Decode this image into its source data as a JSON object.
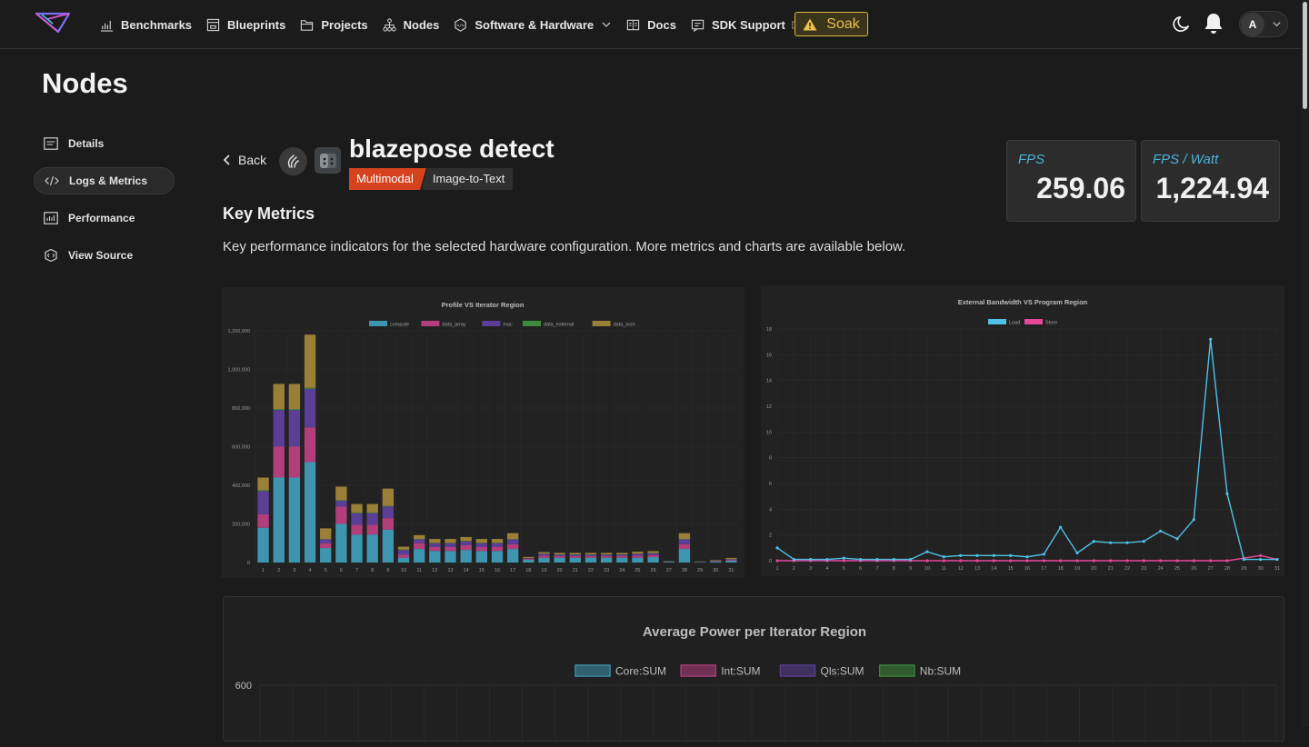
{
  "nav": {
    "items": [
      {
        "label": "Benchmarks",
        "icon": "chart-icon"
      },
      {
        "label": "Blueprints",
        "icon": "blueprint-icon"
      },
      {
        "label": "Projects",
        "icon": "folder-icon"
      },
      {
        "label": "Nodes",
        "icon": "hierarchy-icon"
      },
      {
        "label": "Software & Hardware",
        "icon": "chip-icon"
      },
      {
        "label": "Docs",
        "icon": "book-icon"
      },
      {
        "label": "SDK Support",
        "icon": "support-icon"
      }
    ],
    "soak_label": "Soak",
    "avatar_initial": "A"
  },
  "page": {
    "title": "Nodes"
  },
  "sidebar": {
    "items": [
      {
        "label": "Details",
        "icon": "details-icon"
      },
      {
        "label": "Logs & Metrics",
        "icon": "code-icon",
        "active": true
      },
      {
        "label": "Performance",
        "icon": "performance-icon"
      },
      {
        "label": "View Source",
        "icon": "source-icon"
      }
    ]
  },
  "model": {
    "back_label": "Back",
    "title": "blazepose detect",
    "tag_primary": "Multimodal",
    "tag_secondary": "Image-to-Text"
  },
  "stats": {
    "fps": {
      "label": "FPS",
      "value": "259.06"
    },
    "fps_watt": {
      "label": "FPS / Watt",
      "value": "1,224.94"
    }
  },
  "key_metrics": {
    "title": "Key Metrics",
    "description": "Key performance indicators for the selected hardware configuration. More metrics and charts are available below."
  },
  "colors": {
    "compute": "#3e95b0",
    "data_array": "#b23f7c",
    "mac": "#5b3f96",
    "data_external": "#3d8c3d",
    "data_ocm": "#9a8036",
    "load": "#4fc1e9",
    "store": "#e5489b",
    "accent_red": "#d4431e"
  },
  "chart_data": [
    {
      "type": "bar",
      "stacked": true,
      "title": "Profile VS Iterator Region",
      "categories": [
        "1",
        "2",
        "3",
        "4",
        "5",
        "6",
        "7",
        "8",
        "9",
        "10",
        "11",
        "12",
        "13",
        "14",
        "15",
        "16",
        "17",
        "18",
        "19",
        "20",
        "21",
        "22",
        "23",
        "24",
        "25",
        "26",
        "27",
        "28",
        "29",
        "30",
        "31"
      ],
      "series": [
        {
          "name": "compute",
          "values": [
            180000,
            440000,
            440000,
            520000,
            75000,
            200000,
            145000,
            145000,
            170000,
            25000,
            70000,
            60000,
            60000,
            65000,
            60000,
            60000,
            70000,
            15000,
            25000,
            25000,
            25000,
            25000,
            25000,
            25000,
            25000,
            28000,
            4000,
            70000,
            2000,
            5000,
            10000
          ]
        },
        {
          "name": "data_array",
          "values": [
            70000,
            160000,
            160000,
            180000,
            25000,
            90000,
            50000,
            50000,
            60000,
            15000,
            30000,
            20000,
            20000,
            25000,
            20000,
            20000,
            25000,
            5000,
            10000,
            8000,
            8000,
            8000,
            8000,
            8000,
            10000,
            10000,
            1000,
            25000,
            1000,
            2000,
            4000
          ]
        },
        {
          "name": "mac",
          "values": [
            120000,
            190000,
            190000,
            200000,
            20000,
            30000,
            60000,
            60000,
            60000,
            25000,
            20000,
            20000,
            20000,
            20000,
            20000,
            20000,
            25000,
            3000,
            10000,
            8000,
            8000,
            8000,
            8000,
            8000,
            10000,
            10000,
            1000,
            25000,
            1000,
            2000,
            3000
          ]
        },
        {
          "name": "data_external",
          "values": [
            5000,
            5000,
            5000,
            5000,
            2000,
            3000,
            3000,
            3000,
            3000,
            2000,
            2000,
            2000,
            2000,
            2000,
            2000,
            2000,
            2000,
            1000,
            1000,
            1000,
            1000,
            1000,
            1000,
            1000,
            1000,
            1000,
            500,
            2000,
            500,
            500,
            1000
          ]
        },
        {
          "name": "data_ocm",
          "values": [
            65000,
            130000,
            130000,
            275000,
            55000,
            70000,
            45000,
            45000,
            90000,
            15000,
            20000,
            20000,
            20000,
            20000,
            20000,
            20000,
            30000,
            5000,
            8000,
            8000,
            8000,
            8000,
            8000,
            8000,
            10000,
            10000,
            1000,
            30000,
            1000,
            3000,
            6000
          ]
        }
      ],
      "ylim": [
        0,
        1200000
      ],
      "yticks": [
        "0",
        "200,000",
        "400,000",
        "600,000",
        "800,000",
        "1,000,000",
        "1,200,000"
      ],
      "legend": "top"
    },
    {
      "type": "line",
      "title": "External Bandwidth VS Program Region",
      "x": [
        "1",
        "2",
        "3",
        "4",
        "5",
        "6",
        "7",
        "8",
        "9",
        "10",
        "11",
        "12",
        "13",
        "14",
        "15",
        "16",
        "17",
        "18",
        "19",
        "20",
        "21",
        "22",
        "23",
        "24",
        "25",
        "26",
        "27",
        "28",
        "29",
        "30",
        "31"
      ],
      "series": [
        {
          "name": "Load",
          "values": [
            1.0,
            0.1,
            0.1,
            0.1,
            0.2,
            0.1,
            0.1,
            0.1,
            0.1,
            0.7,
            0.3,
            0.4,
            0.4,
            0.4,
            0.4,
            0.3,
            0.5,
            2.6,
            0.6,
            1.5,
            1.4,
            1.4,
            1.5,
            2.3,
            1.7,
            3.2,
            17.2,
            5.2,
            0.1,
            0.1,
            0.1
          ]
        },
        {
          "name": "Store",
          "values": [
            0,
            0,
            0,
            0,
            0,
            0,
            0,
            0,
            0,
            0,
            0,
            0,
            0,
            0,
            0,
            0,
            0,
            0,
            0,
            0,
            0,
            0,
            0,
            0,
            0,
            0,
            0,
            0,
            0.2,
            0.4,
            0.1
          ]
        }
      ],
      "ylim": [
        0,
        18
      ],
      "yticks": [
        "0",
        "2",
        "4",
        "6",
        "8",
        "10",
        "12",
        "14",
        "16",
        "18"
      ],
      "legend": "top"
    },
    {
      "type": "bar",
      "title": "Average Power per Iterator Region",
      "series": [
        {
          "name": "Core:SUM",
          "values": []
        },
        {
          "name": "Int:SUM",
          "values": []
        },
        {
          "name": "Qls:SUM",
          "values": []
        },
        {
          "name": "Nb:SUM",
          "values": []
        }
      ],
      "ylim_top_label": "600",
      "legend": "top"
    }
  ]
}
